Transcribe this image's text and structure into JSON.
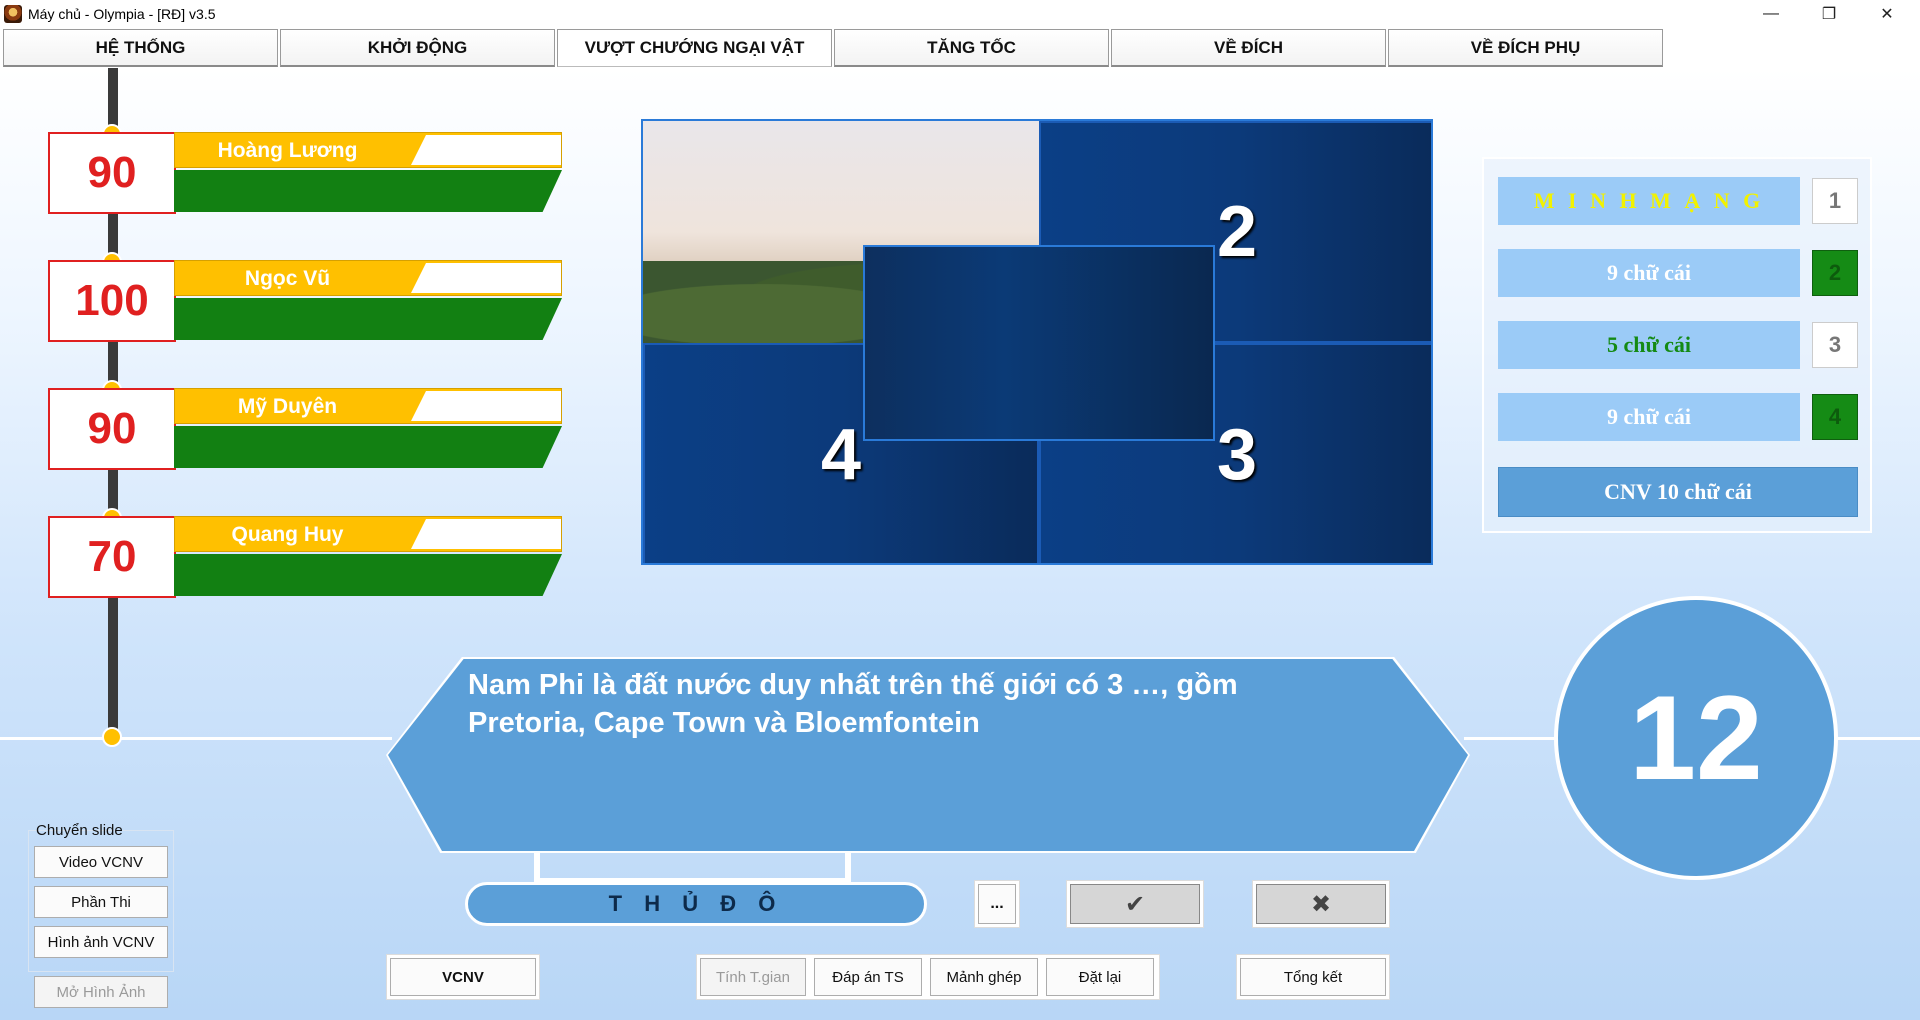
{
  "window": {
    "title": "Máy chủ - Olympia - [RĐ] v3.5",
    "minimize": "—",
    "maximize": "❐",
    "close": "✕"
  },
  "tabs": [
    {
      "label": "HỆ THỐNG"
    },
    {
      "label": "KHỞI ĐỘNG"
    },
    {
      "label": "VƯỢT CHƯỚNG NGẠI VẬT",
      "active": true
    },
    {
      "label": "TĂNG TỐC"
    },
    {
      "label": "VỀ ĐÍCH"
    },
    {
      "label": "VỀ ĐÍCH PHỤ"
    }
  ],
  "players": [
    {
      "name": "Hoàng Lương",
      "score": "90"
    },
    {
      "name": "Ngọc Vũ",
      "score": "100"
    },
    {
      "name": "Mỹ Duyên",
      "score": "90"
    },
    {
      "name": "Quang Huy",
      "score": "70"
    }
  ],
  "puzzle": {
    "pieces": [
      "2",
      "4",
      "3"
    ]
  },
  "keywords": {
    "rows": [
      {
        "text": "M I N H M Ạ N G",
        "number": "1",
        "text_color": "#f2f200",
        "opened": false
      },
      {
        "text": "9 chữ cái",
        "number": "2",
        "text_color": "#ffffff",
        "opened": true
      },
      {
        "text": "5 chữ cái",
        "number": "3",
        "text_color": "#148a14",
        "opened": false
      },
      {
        "text": "9 chữ cái",
        "number": "4",
        "text_color": "#ffffff",
        "opened": true
      }
    ],
    "cnv": "CNV 10 chữ cái"
  },
  "question": {
    "line1": "Nam Phi là đất nước duy nhất trên thế giới có 3 …, gồm",
    "line2": "Pretoria, Cape Town và Bloemfontein"
  },
  "timer": "12",
  "answer": "T H Ủ Đ Ô",
  "buttons": {
    "more": "...",
    "correct": "✔",
    "wrong": "✖",
    "vcnv": "VCNV",
    "tinh_tgian": "Tính T.gian",
    "dap_an_ts": "Đáp án TS",
    "manh_ghep": "Mảnh ghép",
    "dat_lai": "Đặt lại",
    "tong_ket": "Tổng kết"
  },
  "slide_group": {
    "label": "Chuyển slide",
    "video": "Video VCNV",
    "phan_thi": "Phần Thi",
    "hinh_anh": "Hình ảnh VCNV",
    "mo_hinh_anh": "Mở Hình Ảnh"
  },
  "colors": {
    "accent": "#5b9fd8",
    "score_red": "#e02020",
    "name_yellow": "#ffc000",
    "bar_green": "#128012"
  }
}
